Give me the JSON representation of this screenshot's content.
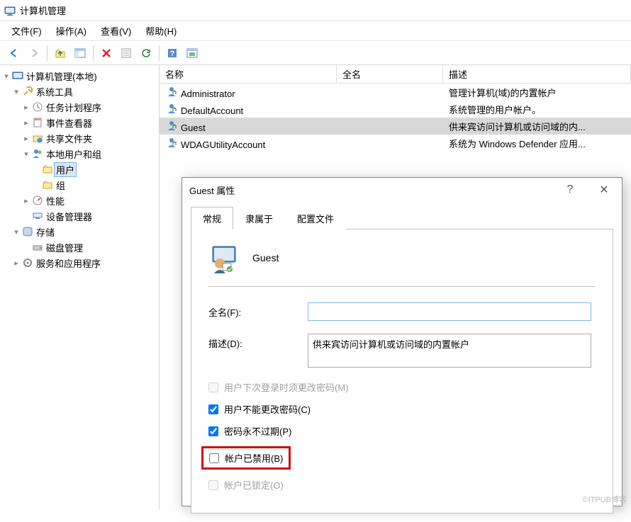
{
  "window": {
    "title": "计算机管理"
  },
  "menu": {
    "file": "文件(F)",
    "action": "操作(A)",
    "view": "查看(V)",
    "help": "帮助(H)"
  },
  "tree": {
    "root": "计算机管理(本地)",
    "systools": "系统工具",
    "tasksched": "任务计划程序",
    "eventviewer": "事件查看器",
    "sharedfolders": "共享文件夹",
    "localusers": "本地用户和组",
    "users": "用户",
    "groups": "组",
    "perf": "性能",
    "devmgr": "设备管理器",
    "storage": "存储",
    "diskmgmt": "磁盘管理",
    "services": "服务和应用程序"
  },
  "list": {
    "col_name": "名称",
    "col_fullname": "全名",
    "col_desc": "描述",
    "rows": [
      {
        "name": "Administrator",
        "full": "",
        "desc": "管理计算机(域)的内置帐户"
      },
      {
        "name": "DefaultAccount",
        "full": "",
        "desc": "系统管理的用户帐户。"
      },
      {
        "name": "Guest",
        "full": "",
        "desc": "供来宾访问计算机或访问域的内..."
      },
      {
        "name": "WDAGUtilityAccount",
        "full": "",
        "desc": "系统为 Windows Defender 应用..."
      }
    ]
  },
  "dialog": {
    "title": "Guest 属性",
    "help_symbol": "?",
    "close_symbol": "✕",
    "tabs": {
      "general": "常规",
      "memberof": "隶属于",
      "profile": "配置文件"
    },
    "username": "Guest",
    "fullname_label": "全名(F):",
    "fullname_value": "",
    "desc_label": "描述(D):",
    "desc_value": "供来宾访问计算机或访问域的内置帐户",
    "chk_mustchange": "用户下次登录时须更改密码(M)",
    "chk_cantchange": "用户不能更改密码(C)",
    "chk_neverexpire": "密码永不过期(P)",
    "chk_disabled": "帐户已禁用(B)",
    "chk_locked": "帐户已锁定(O)"
  },
  "watermark": "©ITPUB博客"
}
